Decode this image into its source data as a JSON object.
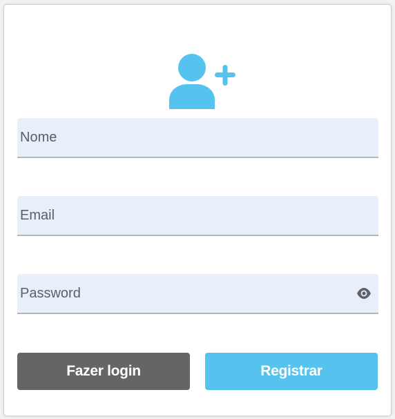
{
  "form": {
    "icon": "user-plus-icon",
    "fields": {
      "name_placeholder": "Nome",
      "email_placeholder": "Email",
      "password_placeholder": "Password",
      "password_toggle_icon": "eye-icon"
    },
    "buttons": {
      "login_label": "Fazer login",
      "register_label": "Registrar"
    }
  },
  "colors": {
    "accent": "#56c2ee",
    "login_button": "#656565",
    "field_background": "#e8effb"
  }
}
